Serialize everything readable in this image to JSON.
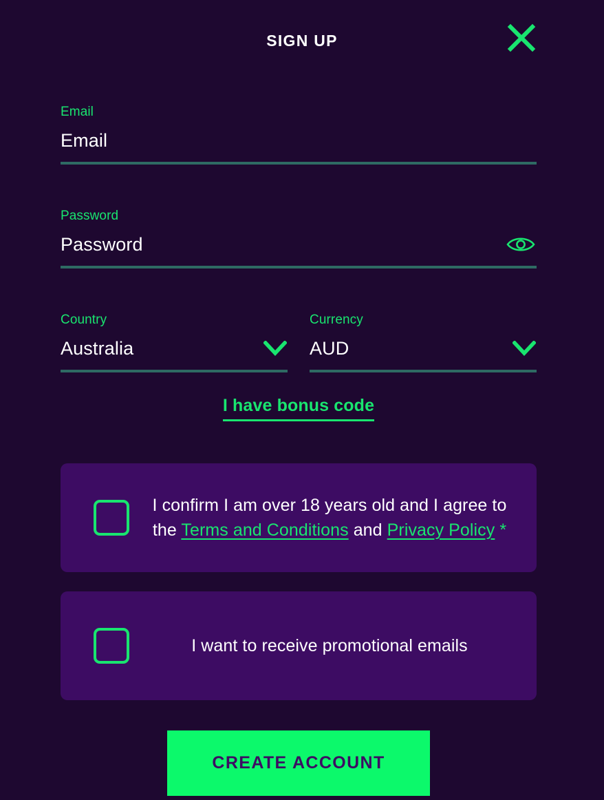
{
  "header": {
    "title": "SIGN UP",
    "close_icon": "close-x-icon"
  },
  "form": {
    "email": {
      "label": "Email",
      "placeholder": "Email",
      "value": ""
    },
    "password": {
      "label": "Password",
      "placeholder": "Password",
      "value": "",
      "toggle_icon": "eye-icon"
    },
    "country": {
      "label": "Country",
      "value": "Australia",
      "chevron_icon": "chevron-down-icon"
    },
    "currency": {
      "label": "Currency",
      "value": "AUD",
      "chevron_icon": "chevron-down-icon"
    },
    "bonus_code_link": "I have bonus code"
  },
  "consent": {
    "age_terms": {
      "text_part_1": "I confirm I am over 18 years old and I agree to the ",
      "link_1": "Terms and Conditions",
      "text_part_2": " and ",
      "link_2": "Privacy Policy",
      "required_marker": " *",
      "checked": false
    },
    "promotional": {
      "text": "I want to receive promotional emails",
      "checked": false
    }
  },
  "submit": {
    "label": "CREATE ACCOUNT"
  },
  "colors": {
    "background": "#1e0830",
    "panel": "#3d0c63",
    "accent_green": "#19e56f",
    "button_green": "#0cf96b",
    "underline_teal": "#2e6a63",
    "text_white": "#ffffff"
  }
}
